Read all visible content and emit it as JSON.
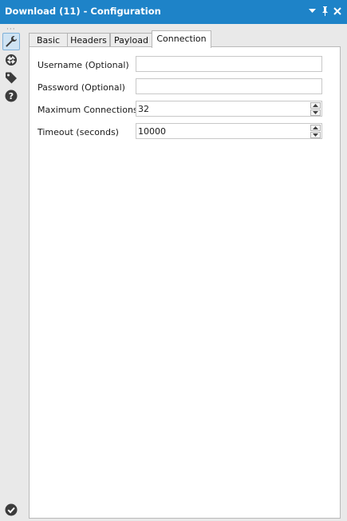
{
  "window": {
    "title": "Download (11) - Configuration",
    "controls": [
      "dropdown-icon",
      "pin-icon",
      "close-icon"
    ]
  },
  "toolstrip": {
    "items": [
      "wrench-icon",
      "target-icon",
      "tag-icon",
      "help-icon"
    ],
    "footer_icon": "check-icon"
  },
  "tabs": [
    {
      "label": "Basic"
    },
    {
      "label": "Headers"
    },
    {
      "label": "Payload"
    },
    {
      "label": "Connection",
      "active": true
    }
  ],
  "form": {
    "username": {
      "label": "Username (Optional)",
      "value": ""
    },
    "password": {
      "label": "Password (Optional)",
      "value": ""
    },
    "max_connections": {
      "label": "Maximum Connections",
      "value": "32"
    },
    "timeout": {
      "label": "Timeout (seconds)",
      "value": "10000"
    }
  },
  "colors": {
    "title_bar": "#1e83c8",
    "icon": "#3c3c3c",
    "active_tool_bg": "#cfe3f3"
  }
}
